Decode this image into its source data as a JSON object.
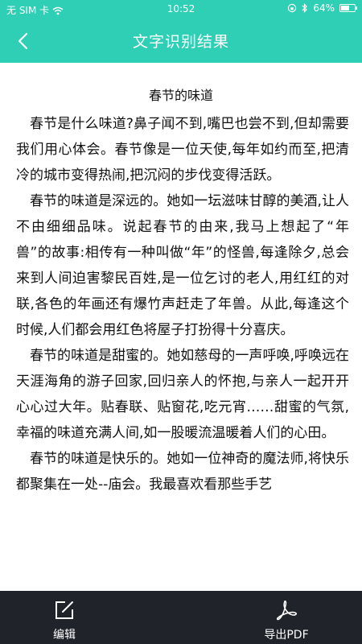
{
  "status_bar": {
    "carrier": "无 SIM 卡",
    "time": "10:52",
    "battery": "64%",
    "battery_level": 0.64
  },
  "header": {
    "title": "文字识别结果"
  },
  "article": {
    "title": "春节的味道",
    "paragraphs": [
      "春节是什么味道?鼻子闻不到,嘴巴也尝不到,但却需要我们用心体会。春节像是一位天使,每年如约而至,把清冷的城市变得热闹,把沉闷的步伐变得活跃。",
      "春节的味道是深远的。她如一坛滋味甘醇的美酒,让人不由细细品味。说起春节的由来,我马上想起了“年兽”的故事:相传有一种叫做“年”的怪兽,每逢除夕,总会来到人间迫害黎民百姓,是一位乞讨的老人,用红红的对联,各色的年画还有爆竹声赶走了年兽。从此,每逢这个时候,人们都会用红色将屋子打扮得十分喜庆。",
      "春节的味道是甜蜜的。她如慈母的一声呼唤,呼唤远在天涯海角的游子回家,回归亲人的怀抱,与亲人一起开开心心过大年。贴春联、贴窗花,吃元宵……甜蜜的气氛,幸福的味道充满人间,如一股暖流温暖着人们的心田。",
      "春节的味道是快乐的。她如一位神奇的魔法师,将快乐都聚集在一处--庙会。我最喜欢看那些手艺"
    ]
  },
  "bottom_bar": {
    "edit_label": "编辑",
    "export_label": "导出PDF"
  }
}
